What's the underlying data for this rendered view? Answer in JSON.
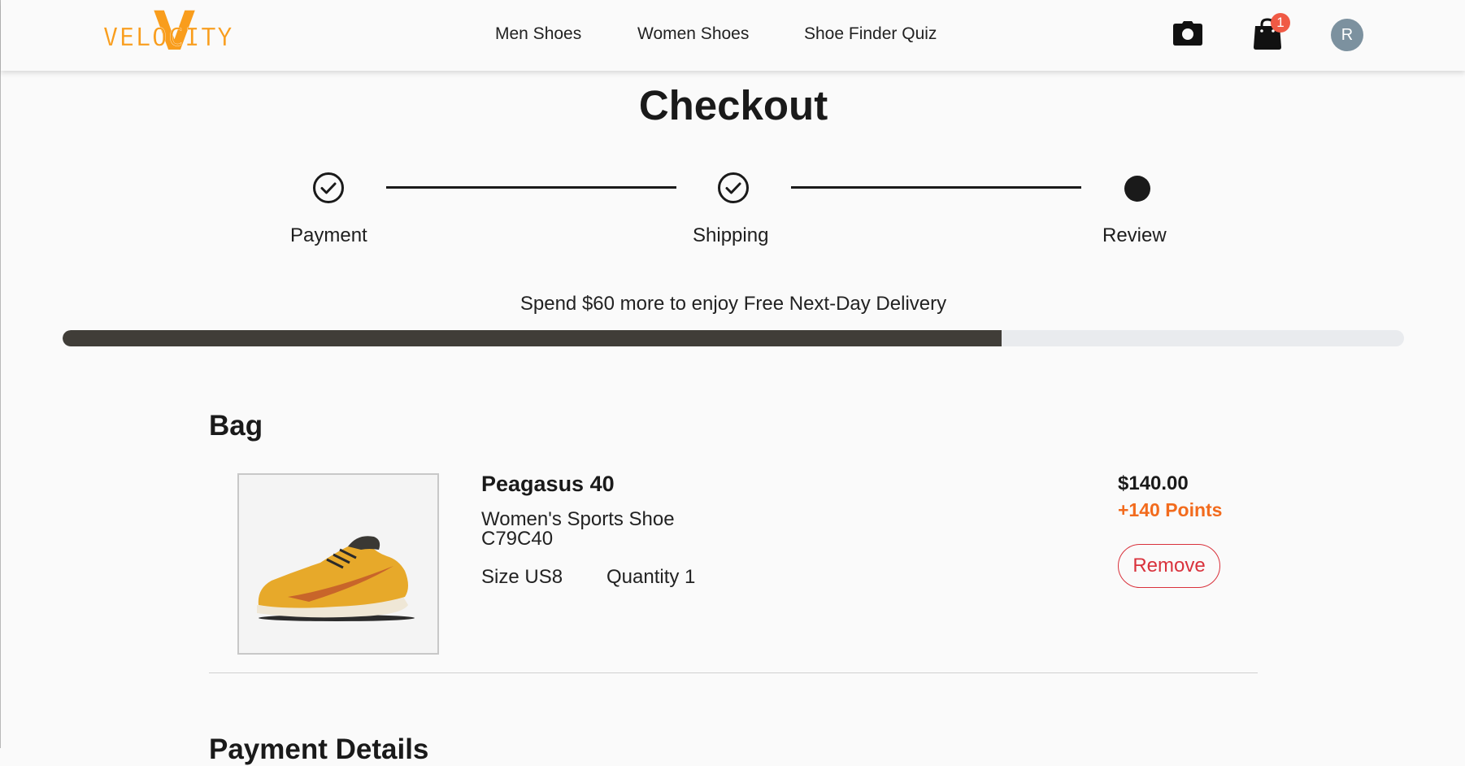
{
  "header": {
    "logo_letter": "V",
    "logo_word": "VELOCITY",
    "logo_color": "#f99d1c",
    "nav": [
      "Men Shoes",
      "Women Shoes",
      "Shoe Finder Quiz"
    ],
    "camera_icon": "camera-icon",
    "bag_icon": "shopping-bag-icon",
    "cart_count": "1",
    "avatar_initial": "R"
  },
  "page_title": "Checkout",
  "stepper": {
    "steps": [
      {
        "label": "Payment",
        "state": "completed"
      },
      {
        "label": "Shipping",
        "state": "completed"
      },
      {
        "label": "Review",
        "state": "current"
      }
    ]
  },
  "delivery": {
    "message": "Spend $60 more to enjoy Free Next-Day Delivery",
    "progress_percent": 70
  },
  "bag": {
    "title": "Bag",
    "items": [
      {
        "name": "Peagasus 40",
        "description": "Women's Sports Shoe",
        "code": "C79C40",
        "size": "Size US8",
        "quantity": "Quantity 1",
        "price": "$140.00",
        "points": "+140 Points",
        "remove_label": "Remove"
      }
    ]
  },
  "next_section_title": "Payment Details",
  "colors": {
    "accent": "#f26b1d",
    "danger": "#d9323c",
    "progress_fill": "#403d38",
    "badge": "#f05a45"
  }
}
